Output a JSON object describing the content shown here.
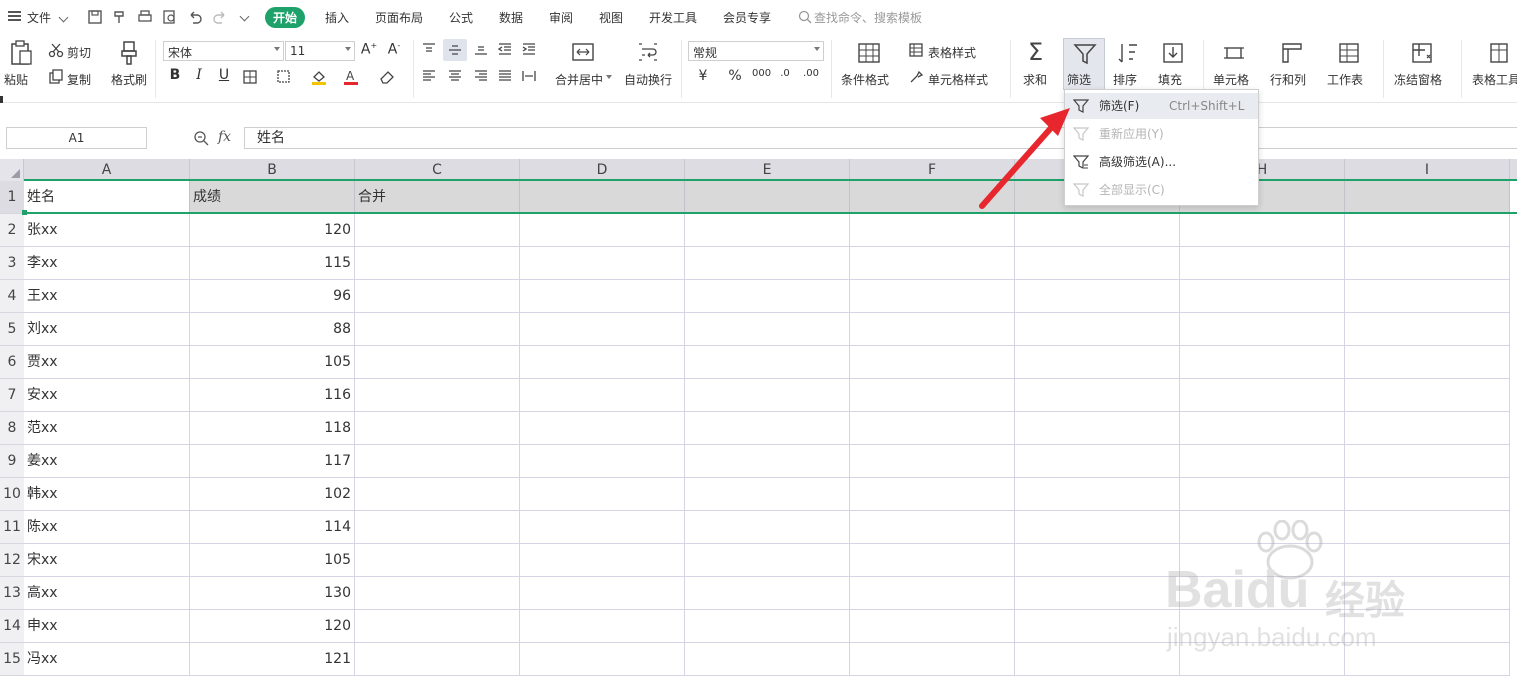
{
  "menubar": {
    "file_label": "文件",
    "tabs": [
      "开始",
      "插入",
      "页面布局",
      "公式",
      "数据",
      "审阅",
      "视图",
      "开发工具",
      "会员专享"
    ],
    "active_tab": "开始",
    "search_placeholder": "查找命令、搜索模板"
  },
  "ribbon": {
    "paste": "粘贴",
    "cut": "剪切",
    "copy": "复制",
    "format_painter": "格式刷",
    "font_name": "宋体",
    "font_size": "11",
    "merge_center": "合并居中",
    "wrap_text": "自动换行",
    "number_format": "常规",
    "cond_format": "条件格式",
    "table_style": "表格样式",
    "cell_style": "单元格样式",
    "sum": "求和",
    "filter": "筛选",
    "sort": "排序",
    "fill": "填充",
    "cell": "单元格",
    "row_col": "行和列",
    "worksheet": "工作表",
    "freeze": "冻结窗格",
    "table_tools": "表格工具"
  },
  "formula_bar": {
    "name_box": "A1",
    "fx": "fx",
    "content": "姓名"
  },
  "grid": {
    "columns": [
      "A",
      "B",
      "C",
      "D",
      "E",
      "F",
      "G",
      "H",
      "I"
    ],
    "rows": [
      {
        "n": "1",
        "name": "姓名",
        "score": "成绩",
        "c": "合并"
      },
      {
        "n": "2",
        "name": "张xx",
        "score": "120",
        "c": ""
      },
      {
        "n": "3",
        "name": "李xx",
        "score": "115",
        "c": ""
      },
      {
        "n": "4",
        "name": "王xx",
        "score": "96",
        "c": ""
      },
      {
        "n": "5",
        "name": "刘xx",
        "score": "88",
        "c": ""
      },
      {
        "n": "6",
        "name": "贾xx",
        "score": "105",
        "c": ""
      },
      {
        "n": "7",
        "name": "安xx",
        "score": "116",
        "c": ""
      },
      {
        "n": "8",
        "name": "范xx",
        "score": "118",
        "c": ""
      },
      {
        "n": "9",
        "name": "姜xx",
        "score": "117",
        "c": ""
      },
      {
        "n": "10",
        "name": "韩xx",
        "score": "102",
        "c": ""
      },
      {
        "n": "11",
        "name": "陈xx",
        "score": "114",
        "c": ""
      },
      {
        "n": "12",
        "name": "宋xx",
        "score": "105",
        "c": ""
      },
      {
        "n": "13",
        "name": "高xx",
        "score": "130",
        "c": ""
      },
      {
        "n": "14",
        "name": "申xx",
        "score": "120",
        "c": ""
      },
      {
        "n": "15",
        "name": "冯xx",
        "score": "121",
        "c": ""
      }
    ]
  },
  "filter_menu": {
    "items": [
      {
        "label": "筛选(F)",
        "shortcut": "Ctrl+Shift+L",
        "disabled": false
      },
      {
        "label": "重新应用(Y)",
        "shortcut": "",
        "disabled": true
      },
      {
        "label": "高级筛选(A)...",
        "shortcut": "",
        "disabled": false
      },
      {
        "label": "全部显示(C)",
        "shortcut": "",
        "disabled": true
      }
    ]
  },
  "watermark": {
    "brand": "Baidu",
    "cn": "经验",
    "url": "jingyan.baidu.com"
  },
  "colors": {
    "accent_green": "#1fa16a",
    "arrow_red": "#e8262d",
    "header_bg": "#dcdce2"
  }
}
